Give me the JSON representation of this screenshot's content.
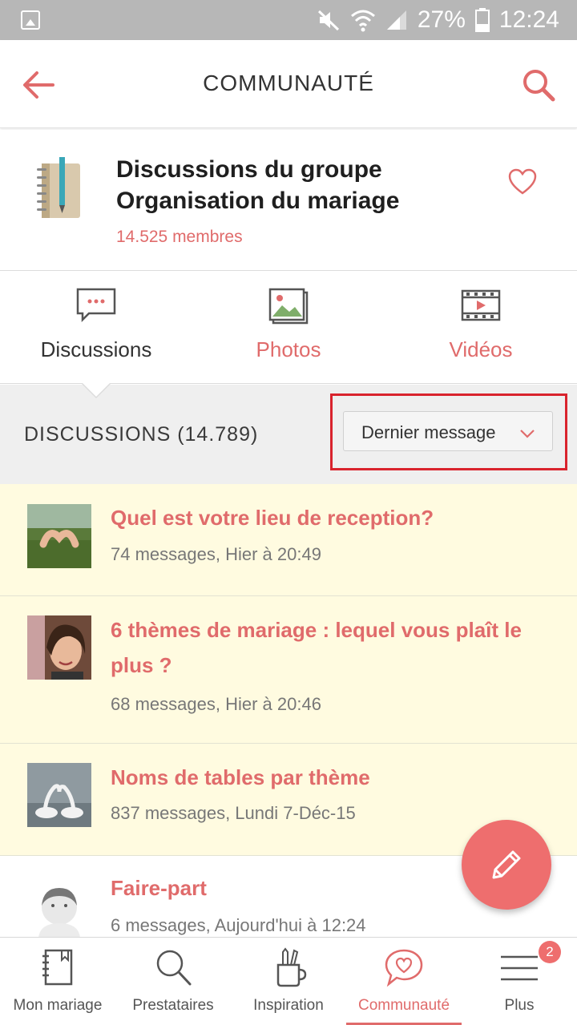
{
  "status_bar": {
    "battery": "27%",
    "time": "12:24"
  },
  "app_bar": {
    "title": "COMMUNAUTÉ",
    "back_icon": "arrow-left-icon",
    "search_icon": "search-icon"
  },
  "group": {
    "title_line1": "Discussions du groupe",
    "title_line2": "Organisation du mariage",
    "members": "14.525 membres",
    "favorite_icon": "heart-icon"
  },
  "tabs": [
    {
      "label": "Discussions",
      "icon": "chat-bubble-icon",
      "active": true
    },
    {
      "label": "Photos",
      "icon": "photos-icon",
      "active": false
    },
    {
      "label": "Vidéos",
      "icon": "video-icon",
      "active": false
    }
  ],
  "list_header": {
    "title": "DISCUSSIONS (14.789)",
    "sort_value": "Dernier message"
  },
  "discussions": [
    {
      "title": "Quel est votre lieu de reception?",
      "meta": "74 messages, Hier à 20:49",
      "thumb": "hands-heart-photo"
    },
    {
      "title": "6 thèmes de mariage : lequel vous plaît le plus ?",
      "meta": "68 messages, Hier à 20:46",
      "thumb": "woman-avatar-photo"
    },
    {
      "title": "Noms de tables par thème",
      "meta": "837 messages, Lundi 7-Déc-15",
      "thumb": "swans-heart-photo"
    },
    {
      "title": "Faire-part",
      "meta": "6 messages, Aujourd'hui à 12:24",
      "thumb": "default-avatar"
    }
  ],
  "fab": {
    "icon": "pencil-icon"
  },
  "bottom_nav": [
    {
      "label": "Mon mariage",
      "icon": "notebook-icon"
    },
    {
      "label": "Prestataires",
      "icon": "search-icon"
    },
    {
      "label": "Inspiration",
      "icon": "pencil-cup-icon"
    },
    {
      "label": "Communauté",
      "icon": "heart-bubble-icon",
      "active": true
    },
    {
      "label": "Plus",
      "icon": "menu-icon"
    }
  ],
  "more_badge": "2",
  "colors": {
    "accent": "#e06b6b",
    "fab": "#ee6e6e",
    "highlight_row": "#fffbe0",
    "sort_outline": "#d9232d"
  }
}
